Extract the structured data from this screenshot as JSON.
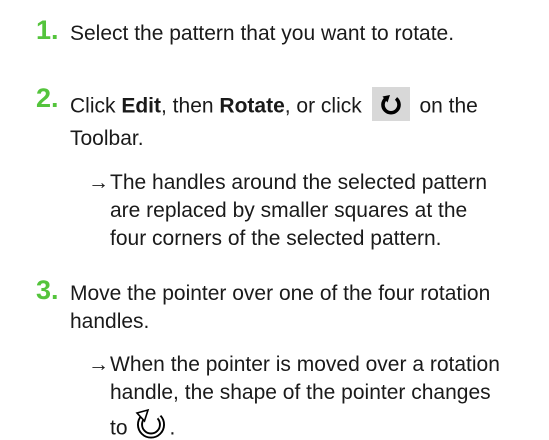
{
  "colors": {
    "step_number": "#54c43c",
    "text": "#1a1a1a",
    "icon_bg": "#d8d8d8"
  },
  "steps": [
    {
      "number": "1.",
      "text": "Select the pattern that you want to rotate."
    },
    {
      "number": "2.",
      "line1_a": "Click ",
      "line1_edit": "Edit",
      "line1_b": ", then ",
      "line1_rotate": "Rotate",
      "line1_c": ", or click",
      "line1_d": "on the",
      "line2": "Toolbar.",
      "arrow": "→",
      "result_lines": [
        "The handles around the selected pattern",
        "are replaced by smaller squares at the",
        "four corners of the selected pattern."
      ]
    },
    {
      "number": "3.",
      "lines": [
        "Move the pointer over one of the four rotation",
        "handles."
      ],
      "arrow": "→",
      "result_lines": [
        "When the pointer is moved over a rotation",
        "handle, the shape of the pointer changes",
        "to",
        "."
      ]
    }
  ],
  "icons": {
    "toolbar_rotate": "rotate-tool-icon",
    "rotate_pointer": "rotate-pointer-icon"
  }
}
